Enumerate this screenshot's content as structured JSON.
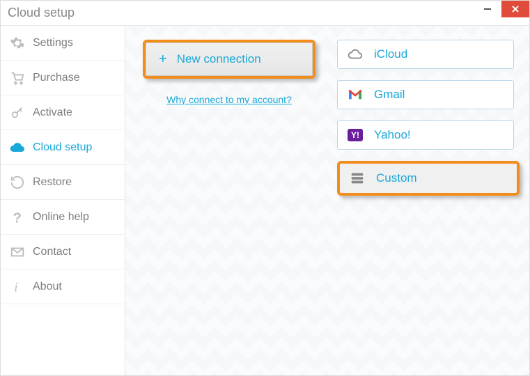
{
  "window": {
    "title": "Cloud setup"
  },
  "sidebar": {
    "items": [
      {
        "label": "Settings"
      },
      {
        "label": "Purchase"
      },
      {
        "label": "Activate"
      },
      {
        "label": "Cloud setup"
      },
      {
        "label": "Restore"
      },
      {
        "label": "Online help"
      },
      {
        "label": "Contact"
      },
      {
        "label": "About"
      }
    ]
  },
  "main": {
    "new_connection_label": "New connection",
    "why_link": "Why connect to my account?",
    "providers": [
      {
        "label": "iCloud"
      },
      {
        "label": "Gmail"
      },
      {
        "label": "Yahoo!"
      },
      {
        "label": "Custom"
      }
    ]
  }
}
